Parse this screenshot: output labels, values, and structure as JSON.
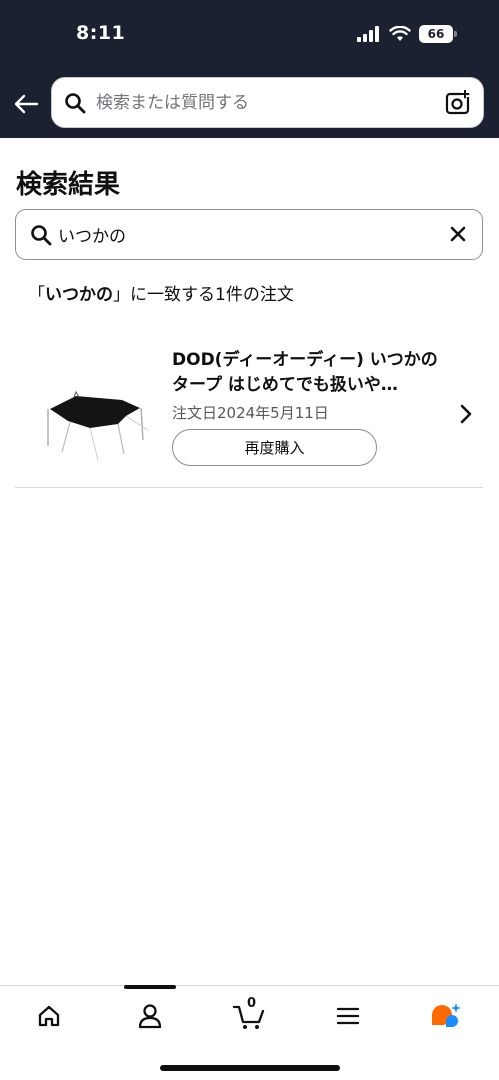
{
  "status_bar": {
    "time": "8:11",
    "battery": "66"
  },
  "header": {
    "search_placeholder": "検索または質問する"
  },
  "page": {
    "title": "検索結果"
  },
  "order_search": {
    "value": "いつかの"
  },
  "summary": {
    "open_quote": "「",
    "term": "いつかの",
    "suffix": "」に一致する1件の注文"
  },
  "orders": [
    {
      "title": "DOD(ディーオーディー) いつかのタープ はじめてでも扱いや…",
      "order_date": "注文日2024年5月11日",
      "rebuy_label": "再度購入"
    }
  ],
  "bottom_nav": {
    "cart_count": "0"
  },
  "colors": {
    "header_bg": "#1b2130",
    "chat_orange": "#ff6a00",
    "chat_blue": "#1a8cff"
  },
  "icons": [
    "back-arrow-icon",
    "search-icon",
    "camera-icon",
    "close-icon",
    "chevron-right-icon",
    "home-icon",
    "person-icon",
    "cart-icon",
    "menu-icon",
    "ai-chat-icon"
  ]
}
